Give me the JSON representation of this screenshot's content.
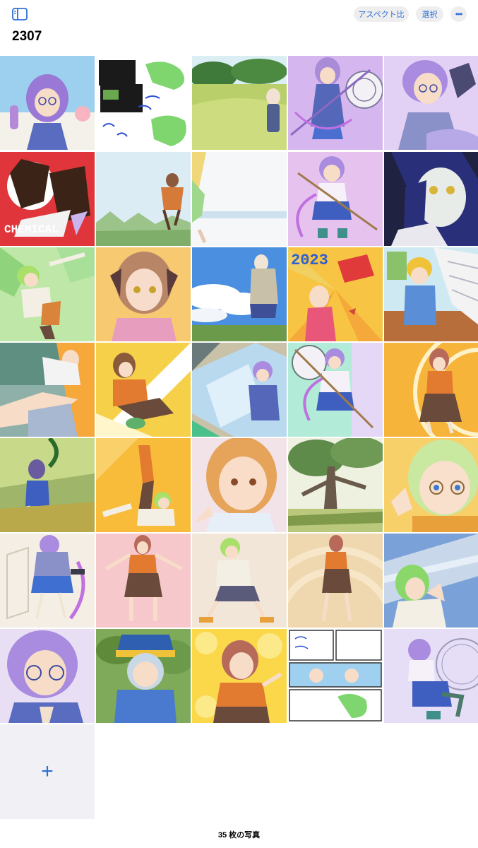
{
  "toolbar": {
    "sidebar_icon": "sidebar-icon",
    "aspect_label": "アスペクト比",
    "select_label": "選択",
    "more_label": "•••",
    "accent_color": "#2f6fd6"
  },
  "album": {
    "title": "2307"
  },
  "photos": {
    "count": 35,
    "captions": {
      "tile_6": "CHEMICAL",
      "tile_14": "2023"
    }
  },
  "add_button": {
    "label": "+"
  },
  "footer": {
    "count_label": "35 枚の写真"
  }
}
